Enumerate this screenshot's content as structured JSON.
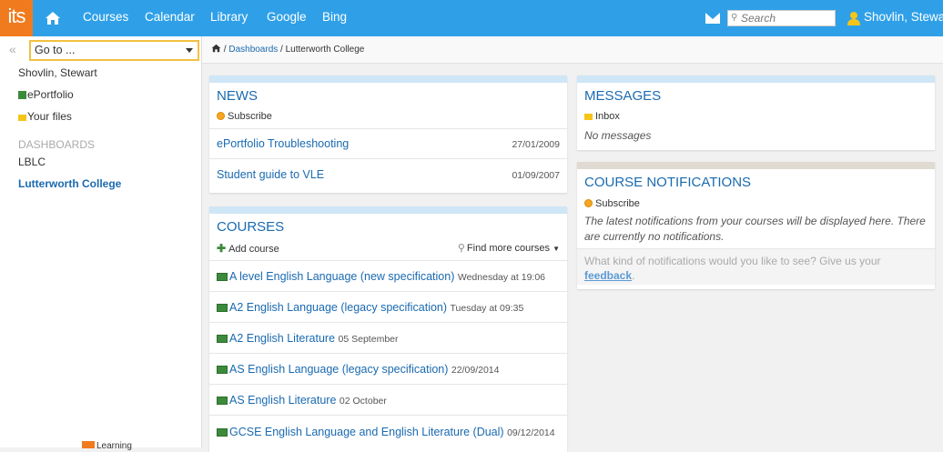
{
  "topbar": {
    "logo": "its",
    "nav": [
      "Courses",
      "Calendar",
      "Library",
      "Google",
      "Bing"
    ],
    "search_placeholder": "Search",
    "user_name": "Shovlin, Stewart"
  },
  "sidebar": {
    "goto_label": "Go to ...",
    "user": "Shovlin, Stewart",
    "eportfolio": "ePortfolio",
    "your_files": "Your files",
    "dashboards_heading": "DASHBOARDS",
    "dashboards": [
      "LBLC",
      "Lutterworth College"
    ],
    "footer": "Learning"
  },
  "breadcrumb": {
    "dashboards": "Dashboards",
    "current": "Lutterworth College"
  },
  "news": {
    "title": "NEWS",
    "subscribe": "Subscribe",
    "items": [
      {
        "title": "ePortfolio Troubleshooting",
        "date": "27/01/2009"
      },
      {
        "title": "Student guide to VLE",
        "date": "01/09/2007"
      }
    ]
  },
  "courses": {
    "title": "COURSES",
    "add_course": "Add course",
    "find_more": "Find more courses",
    "items": [
      {
        "name": "A level English Language (new specification)",
        "when": "Wednesday at 19:06"
      },
      {
        "name": "A2 English Language (legacy specification)",
        "when": "Tuesday at 09:35"
      },
      {
        "name": "A2 English Literature",
        "when": "05 September"
      },
      {
        "name": "AS English Language (legacy specification)",
        "when": "22/09/2014"
      },
      {
        "name": "AS English Literature",
        "when": "02 October"
      },
      {
        "name": "GCSE English Language and English Literature (Dual)",
        "when": "09/12/2014"
      }
    ]
  },
  "messages": {
    "title": "MESSAGES",
    "inbox": "Inbox",
    "empty": "No messages"
  },
  "notifications": {
    "title": "COURSE NOTIFICATIONS",
    "subscribe": "Subscribe",
    "empty": "The latest notifications from your courses will be displayed here. There are currently no notifications.",
    "feedback_prompt": "What kind of notifications would you like to see? Give us your",
    "feedback_link": "feedback",
    "feedback_end": "."
  },
  "colors": {
    "topbar": "#2fa0e8",
    "logo": "#f07b1e",
    "link": "#1a6ab0",
    "goto_border": "#f0c040"
  }
}
